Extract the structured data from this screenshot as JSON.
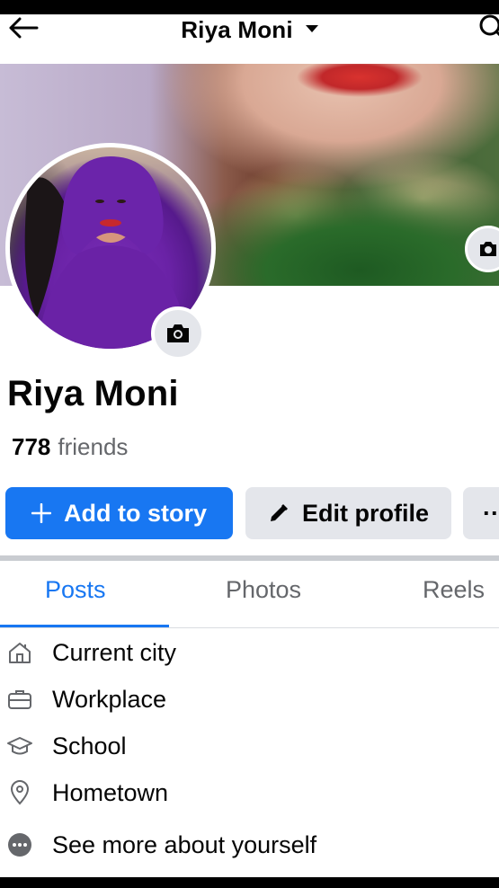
{
  "header": {
    "title": "Riya Moni"
  },
  "profile": {
    "name": "Riya Moni",
    "friends_count": "778",
    "friends_label": "friends"
  },
  "actions": {
    "add_story_label": "Add to story",
    "edit_profile_label": "Edit profile",
    "more_label": "··"
  },
  "tabs": [
    {
      "label": "Posts",
      "active": true
    },
    {
      "label": "Photos",
      "active": false
    },
    {
      "label": "Reels",
      "active": false
    }
  ],
  "details": [
    {
      "label": "Current city",
      "icon": "home-icon"
    },
    {
      "label": "Workplace",
      "icon": "briefcase-icon"
    },
    {
      "label": "School",
      "icon": "graduation-cap-icon"
    },
    {
      "label": "Hometown",
      "icon": "location-pin-icon"
    },
    {
      "label": "See more about yourself",
      "icon": "more-dots-icon"
    }
  ],
  "colors": {
    "accent": "#1877f2",
    "secondary_button": "#e4e6eb",
    "muted_text": "#65676b"
  }
}
